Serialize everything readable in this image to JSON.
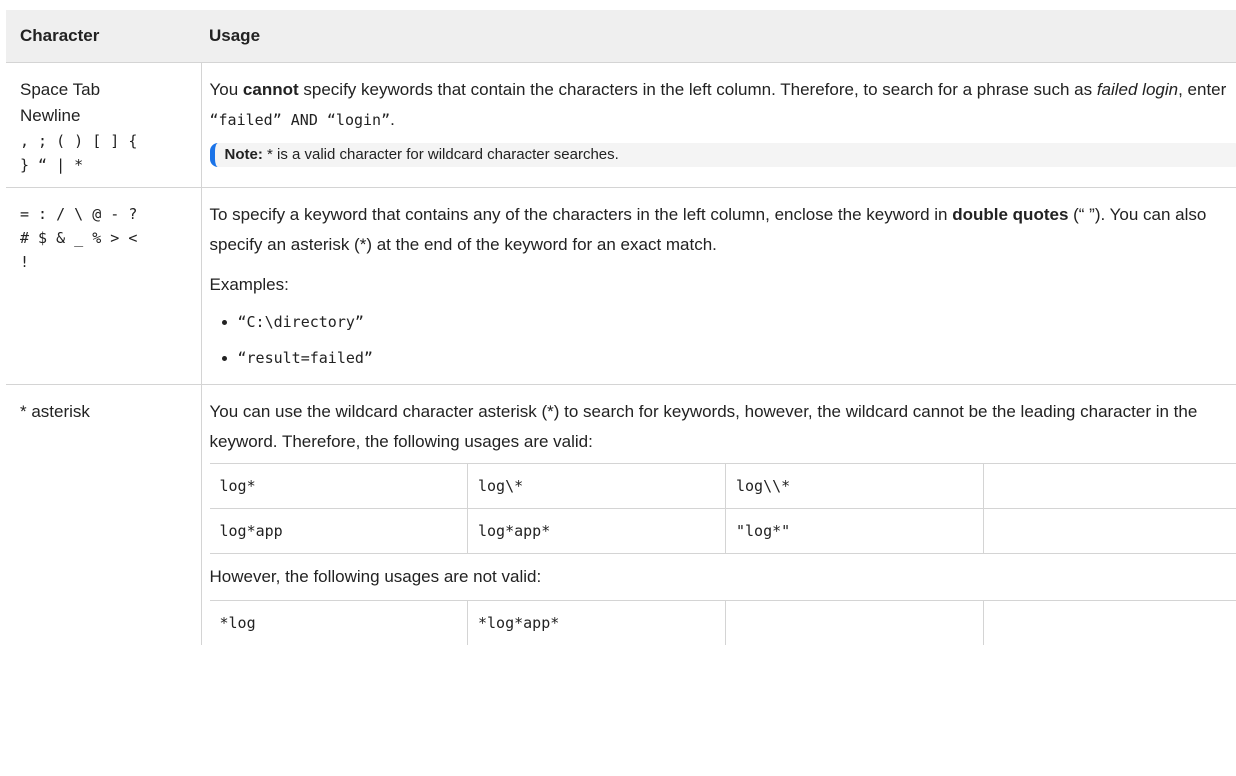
{
  "header": {
    "col1": "Character",
    "col2": "Usage"
  },
  "row1": {
    "chars_line1": "Space Tab",
    "chars_line2": "Newline",
    "chars_line3": ", ; ( ) [ ] {",
    "chars_line4": "} “ | *",
    "text_a": "You ",
    "text_b": "cannot",
    "text_c": " specify keywords that contain the characters in the left column. Therefore, to search for a phrase such as ",
    "text_d": "failed login",
    "text_e": ", enter ",
    "code1": "“failed” AND “login”",
    "text_f": ".",
    "note_label": "Note:",
    "note_text": " * is a valid character for wildcard character searches."
  },
  "row2": {
    "chars_line1": "= : / \\ @ - ?",
    "chars_line2": "# $ & _ % > <",
    "chars_line3": "!",
    "text_a": "To specify a keyword that contains any of the characters in the left column, enclose the keyword in ",
    "text_b": "double quotes",
    "text_c": " (“ ”). You can also specify an asterisk (*) at the end of the keyword for an exact match.",
    "examples_label": "Examples:",
    "examples": [
      "“C:\\directory”",
      "“result=failed”"
    ]
  },
  "row3": {
    "chars": "* asterisk",
    "text": "You can use the wildcard character asterisk (*) to search for keywords, however, the wildcard cannot be the leading character in the keyword. Therefore, the following usages are valid:",
    "valid": [
      [
        "log*",
        "log\\*",
        "log\\\\*",
        ""
      ],
      [
        "log*app",
        "log*app*",
        "\"log*\"",
        ""
      ]
    ],
    "invalid_label": "However, the following usages are not valid:",
    "invalid": [
      [
        "*log",
        "*log*app*",
        "",
        ""
      ]
    ]
  }
}
